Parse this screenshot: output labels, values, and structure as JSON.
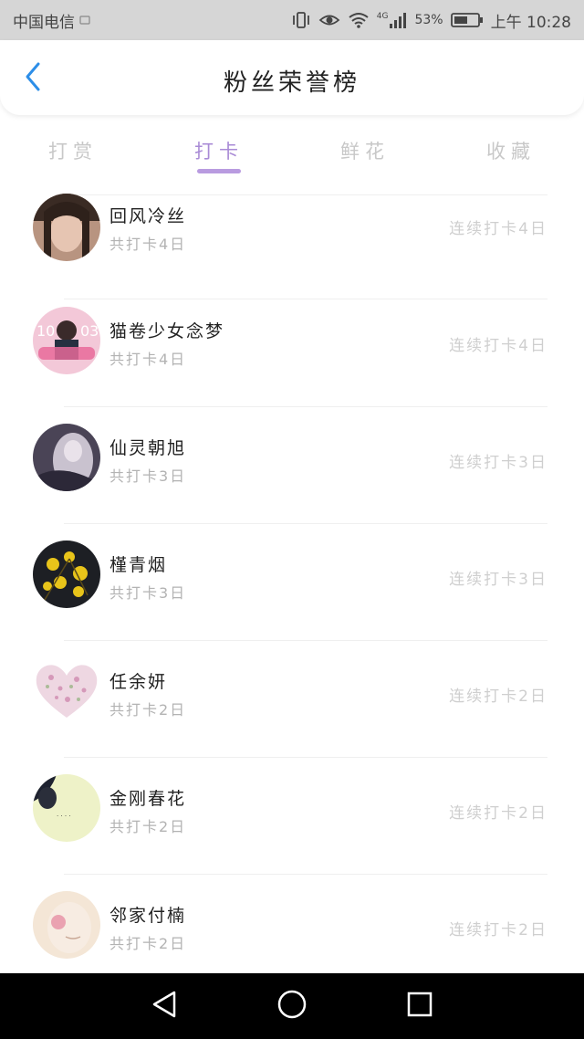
{
  "status_bar": {
    "carrier": "中国电信",
    "battery_percent": "53%",
    "network": "4G",
    "time": "上午 10:28",
    "icons": [
      "vibrate-icon",
      "eye-icon",
      "wifi-icon",
      "signal-icon",
      "battery-icon"
    ]
  },
  "header": {
    "title": "粉丝荣誉榜",
    "back_icon": "chevron-left-icon"
  },
  "tabs": [
    {
      "label": "打赏",
      "active": false
    },
    {
      "label": "打卡",
      "active": true
    },
    {
      "label": "鲜花",
      "active": false
    },
    {
      "label": "收藏",
      "active": false
    }
  ],
  "colors": {
    "accent": "#b99be0",
    "tab_active_text": "#a98bd6",
    "muted_text": "#c8c8c8"
  },
  "list": [
    {
      "name": "回风冷丝",
      "total": "共打卡4日",
      "streak": "连续打卡4日"
    },
    {
      "name": "猫卷少女念梦",
      "total": "共打卡4日",
      "streak": "连续打卡4日"
    },
    {
      "name": "仙灵朝旭",
      "total": "共打卡3日",
      "streak": "连续打卡3日"
    },
    {
      "name": "槿青烟",
      "total": "共打卡3日",
      "streak": "连续打卡3日"
    },
    {
      "name": "任余妍",
      "total": "共打卡2日",
      "streak": "连续打卡2日"
    },
    {
      "name": "金刚春花",
      "total": "共打卡2日",
      "streak": "连续打卡2日"
    },
    {
      "name": "邻家付楠",
      "total": "共打卡2日",
      "streak": "连续打卡2日"
    }
  ],
  "nav_bar": {
    "icons": [
      "back-triangle-icon",
      "home-circle-icon",
      "recents-square-icon"
    ]
  }
}
